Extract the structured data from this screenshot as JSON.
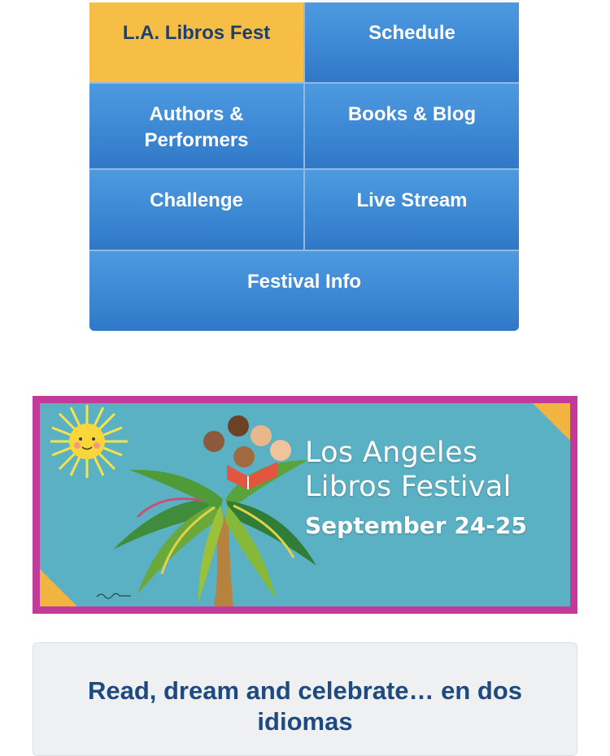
{
  "nav": {
    "items": [
      {
        "label": "L.A. Libros Fest",
        "active": true
      },
      {
        "label": "Schedule"
      },
      {
        "label_line1": "Authors &",
        "label_line2": "Performers"
      },
      {
        "label": "Books & Blog"
      },
      {
        "label": "Challenge"
      },
      {
        "label": "Live Stream"
      },
      {
        "label": "Festival Info"
      }
    ],
    "colors": {
      "tile": "#3d88d4",
      "active": "#f7be45",
      "active_text": "#1e3f6e"
    }
  },
  "banner": {
    "line1": "Los Angeles",
    "line2": "Libros Festival",
    "dates": "September 24-25",
    "colors": {
      "frame": "#c23a9a",
      "background": "#5bb1c4",
      "corners": "#f2b441"
    }
  },
  "tagline": "Read, dream and celebrate… en dos idiomas"
}
